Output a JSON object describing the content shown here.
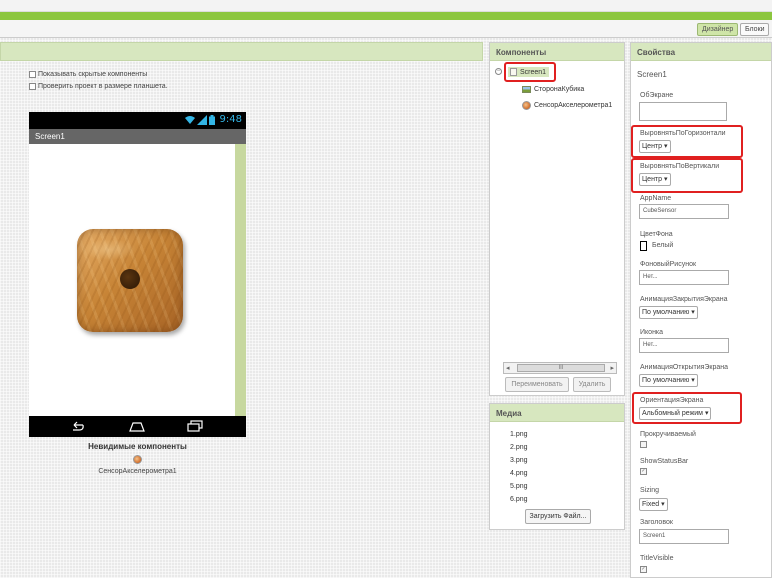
{
  "toolbar": {
    "designer_label": "Дизайнер",
    "blocks_label": "Блоки"
  },
  "viewer": {
    "show_hidden_label": "Показывать скрытые компоненты",
    "tablet_size_label": "Проверить проект в размере планшета.",
    "phone": {
      "time": "9:48",
      "screen_title": "Screen1"
    },
    "invisible_title": "Невидимые компоненты",
    "invisible_item": "СенсорАкселерометра1"
  },
  "components": {
    "title": "Компоненты",
    "screen": "Screen1",
    "children": [
      "СторонаКубика",
      "СенсорАкселерометра1"
    ],
    "rename_button": "Переименовать",
    "delete_button": "Удалить",
    "scroll_thumb": "III"
  },
  "media": {
    "title": "Медиа",
    "files": [
      "1.png",
      "2.png",
      "3.png",
      "4.png",
      "5.png",
      "6.png"
    ],
    "upload_button": "Загрузить Файл..."
  },
  "properties": {
    "title": "Свойства",
    "screen_name": "Screen1",
    "about_label": "ОбЭкране",
    "align_h_label": "ВыровнятьПоГоризонтали",
    "align_h_value": "Центр",
    "align_v_label": "ВыровнятьПоВертикали",
    "align_v_value": "Центр",
    "appname_label": "AppName",
    "appname_value": "CubeSensor",
    "bgcolor_label": "ЦветФона",
    "bgcolor_value": "Белый",
    "bgimage_label": "ФоновыйРисунок",
    "bgimage_value": "Нет...",
    "close_anim_label": "АнимацияЗакрытияЭкрана",
    "close_anim_value": "По умолчанию",
    "icon_label": "Иконка",
    "icon_value": "Нет...",
    "open_anim_label": "АнимацияОткрытияЭкрана",
    "open_anim_value": "По умолчанию",
    "orientation_label": "ОриентацияЭкрана",
    "orientation_value": "Альбомный режим",
    "scrollable_label": "Прокручиваемый",
    "statusbar_label": "ShowStatusBar",
    "sizing_label": "Sizing",
    "sizing_value": "Fixed",
    "title_label": "Заголовок",
    "title_value": "Screen1",
    "title_visible_label": "TitleVisible"
  },
  "colors": {
    "accent_green": "#8cc63f",
    "header_green": "#d7e7bf",
    "highlight_red": "#e02020",
    "status_blue": "#33b5e5"
  }
}
